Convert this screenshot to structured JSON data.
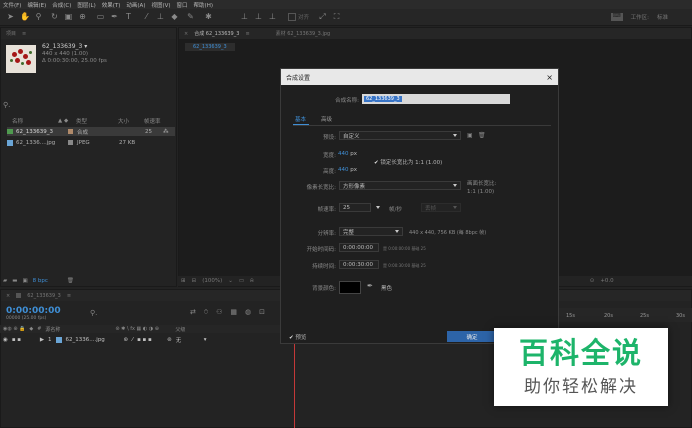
{
  "menu": [
    "文件(F)",
    "编辑(E)",
    "合成(C)",
    "图层(L)",
    "效果(T)",
    "动画(A)",
    "视图(V)",
    "窗口",
    "帮助(H)"
  ],
  "toolbar": {
    "align_label": "对齐",
    "workspace_label": "工作区:",
    "workspace_value": "标准"
  },
  "project": {
    "tab": "项目",
    "comp_name": "62_133639_3 ▾",
    "comp_size": "440 x 440 (1.00)",
    "comp_duration": "Δ 0:00:30:00, 25.00 fps",
    "search_placeholder": "",
    "columns": [
      "名称",
      "类型",
      "大小",
      "帧速率"
    ],
    "items": [
      {
        "name": "62_133639_3",
        "type": "合成",
        "size": "",
        "fps": "25"
      },
      {
        "name": "62_1336....jpg",
        "type": "JPEG",
        "size": "27 KB",
        "fps": ""
      }
    ],
    "bpc": "8 bpc"
  },
  "viewer": {
    "tab_comp": "合成 62_133639_3",
    "tab_footage": "素材 62_133639_3.jpg",
    "breadcrumb": "62_133639_3",
    "zoom": "(100%)",
    "offset": "+0.0"
  },
  "dialog": {
    "title": "合成设置",
    "name_label": "合成名称:",
    "name_value": "62_133639_3",
    "tab_basic": "基本",
    "tab_advanced": "高级",
    "preset_label": "预设:",
    "preset_value": "自定义",
    "width_label": "宽度:",
    "width_value": "440",
    "height_label": "高度:",
    "height_value": "440",
    "px": "px",
    "lock_label": "锁定长宽比为 1:1 (1.00)",
    "par_label": "像素长宽比:",
    "par_value": "方形像素",
    "frame_ar_label": "画面长宽比:",
    "frame_ar_value": "1:1 (1.00)",
    "fps_label": "帧速率:",
    "fps_value": "25",
    "fps_unit": "帧/秒",
    "drop_frame": "丢帧",
    "res_label": "分辨率:",
    "res_value": "完整",
    "res_info": "440 x 440, 756 KB (每 8bpc 帧)",
    "start_label": "开始时间码:",
    "start_value": "0:00:00:00",
    "start_info": "是 0:00:00:00 基础 25",
    "dur_label": "持续时间:",
    "dur_value": "0:00:30:00",
    "dur_info": "是 0:00:30:00 基础 25",
    "bg_label": "背景颜色:",
    "bg_name": "黑色",
    "bg_color": "#000000",
    "preview_label": "预览",
    "ok_label": "确定"
  },
  "timeline": {
    "tab": "62_133639_3",
    "timecode": "0:00:00:00",
    "frames": "00000 (25.00 fps)",
    "col_source": "源名称",
    "col_parent": "父级",
    "layer_index": "1",
    "layer_name": "62_1336....jpg",
    "parent_value": "无",
    "ruler_marks": [
      "15s",
      "20s",
      "25s",
      "30s"
    ]
  },
  "watermark": {
    "line1": "百科全说",
    "line2": "助你轻松解决"
  }
}
